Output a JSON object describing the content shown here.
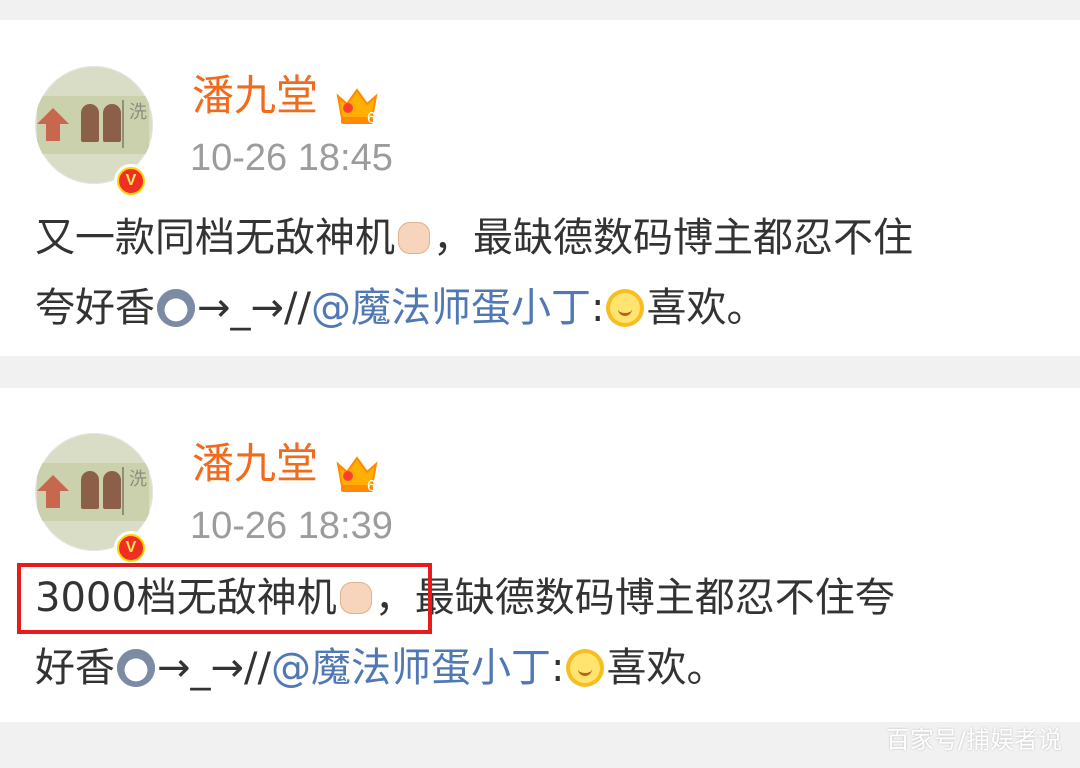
{
  "posts": [
    {
      "username": "潘九堂",
      "timestamp": "10-26 18:45",
      "line1": {
        "text_a": "又一款同档无敌神机",
        "emoji_a": "thumbs-up-emoji",
        "text_b": "，最缺德数码博主都忍不住"
      },
      "line2": {
        "text_a": "夸好香",
        "emoji_a": "husky-emoji",
        "text_b": "→_→//",
        "mention": "@魔法师蛋小丁",
        "text_c": ":",
        "emoji_b": "smile-emoji",
        "text_d": "喜欢。"
      }
    },
    {
      "username": "潘九堂",
      "timestamp": "10-26 18:39",
      "line1": {
        "text_a": "3000档无敌神机",
        "emoji_a": "thumbs-up-emoji",
        "text_b": "，最缺德数码博主都忍不住夸"
      },
      "line2": {
        "text_a": "好香",
        "emoji_a": "husky-emoji",
        "text_b": "→_→//",
        "mention": "@魔法师蛋小丁",
        "text_c": ":",
        "emoji_b": "smile-emoji",
        "text_d": "喜欢。"
      }
    }
  ],
  "watermark": "百家号/捕娱者说",
  "colors": {
    "username": "#f26a1b",
    "timestamp": "#9c9c9c",
    "body_text": "#333333",
    "mention": "#4f78b5",
    "highlight_box": "#e61b1b",
    "verified_badge": "#ffd400"
  }
}
